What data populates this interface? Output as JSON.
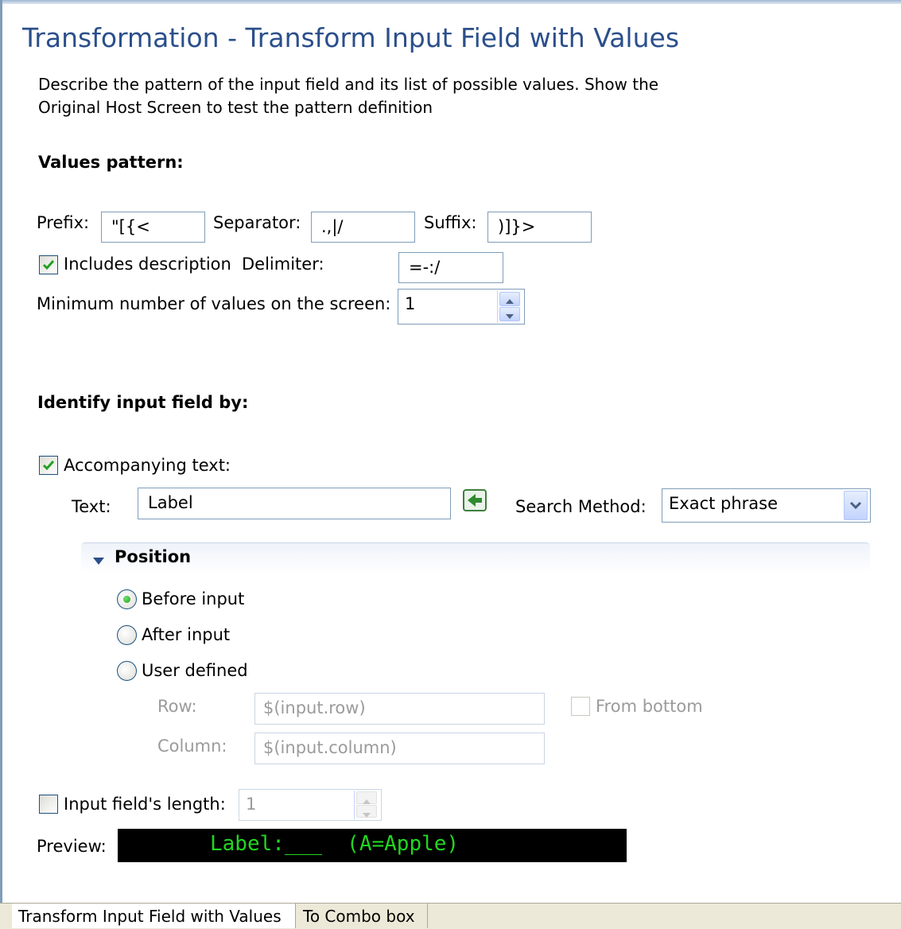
{
  "page": {
    "title": "Transformation - Transform Input Field with Values",
    "description": "Describe the pattern of the input field and its list of possible values. Show the Original Host Screen to test the pattern definition"
  },
  "values_pattern": {
    "heading": "Values pattern:",
    "prefix_label": "Prefix:",
    "prefix_value": "\"[{<",
    "separator_label": "Separator:",
    "separator_value": ".,|/",
    "suffix_label": "Suffix:",
    "suffix_value": ")]}>",
    "includes_description_label": "Includes description",
    "includes_description_checked": true,
    "delimiter_label": "Delimiter:",
    "delimiter_value": "=-:/",
    "min_values_label": "Minimum number of values on the screen:",
    "min_values_value": "1"
  },
  "identify": {
    "heading": "Identify input field by:",
    "accompanying_label": "Accompanying text:",
    "accompanying_checked": true,
    "text_label": "Text:",
    "text_value": "Label",
    "search_method_label": "Search Method:",
    "search_method_value": "Exact phrase"
  },
  "position": {
    "heading": "Position",
    "options": [
      "Before input",
      "After input",
      "User defined"
    ],
    "selected": "Before input",
    "row_label": "Row:",
    "row_value": "$(input.row)",
    "column_label": "Column:",
    "column_value": "$(input.column)",
    "from_bottom_label": "From bottom"
  },
  "length": {
    "label": "Input field's length:",
    "checked": false,
    "value": "1"
  },
  "preview": {
    "label": "Preview:",
    "text": "Label:___  (A=Apple)"
  },
  "tabs": [
    "Transform Input Field with Values",
    "To Combo box"
  ],
  "colors": {
    "title": "#2b4f8b",
    "preview_bg": "#000000",
    "preview_fg": "#22d622",
    "check": "#21a121"
  },
  "icons": {
    "checkbox_check": "check-icon",
    "insert_text": "insert-text-icon",
    "dropdown": "chevron-down-icon",
    "collapse": "triangle-down-icon"
  }
}
